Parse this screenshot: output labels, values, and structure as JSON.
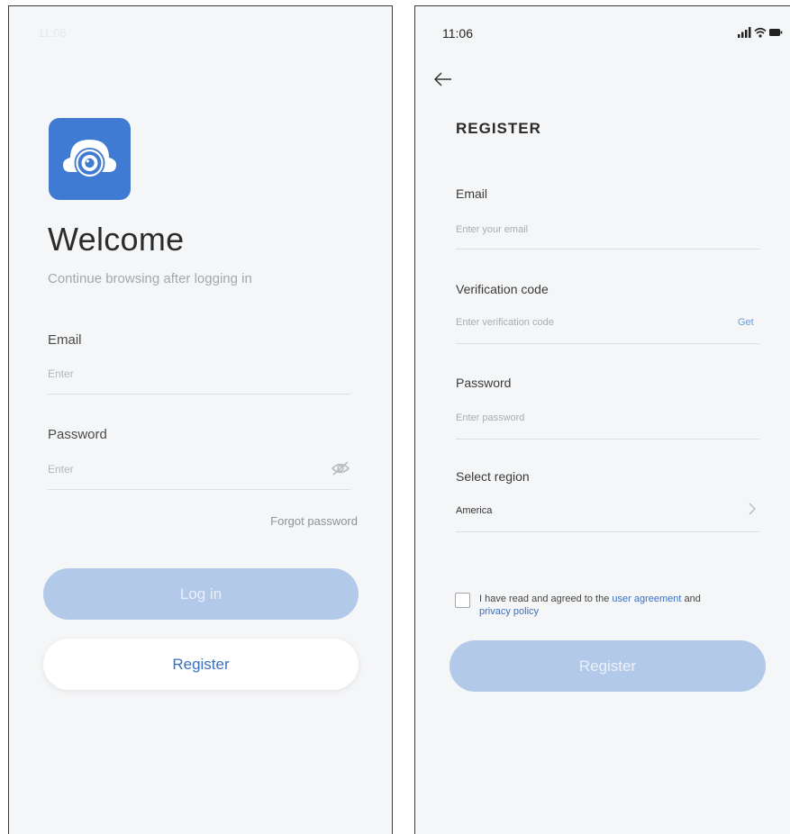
{
  "login_screen": {
    "ghost_status_time": "11:06",
    "welcome_title": "Welcome",
    "subtitle": "Continue browsing after logging in",
    "email": {
      "label": "Email",
      "placeholder": "Enter"
    },
    "password": {
      "label": "Password",
      "placeholder": "Enter"
    },
    "forgot_password": "Forgot password",
    "login_button": "Log in",
    "register_button": "Register",
    "logo_icon": "camera-app-logo-icon",
    "password_toggle_icon": "eye-off-icon",
    "colors": {
      "logo": "#3f7bd3",
      "primary_disabled": "#b2c9ea",
      "link": "#3a6fc0"
    }
  },
  "register_screen": {
    "status_bar": {
      "time": "11:06",
      "icons": [
        "signal-icon",
        "wifi-icon",
        "battery-icon"
      ]
    },
    "back_icon": "back-arrow-icon",
    "title": "REGISTER",
    "email": {
      "label": "Email",
      "placeholder": "Enter your email"
    },
    "verification": {
      "label": "Verification code",
      "placeholder": "Enter verification code",
      "action": "Get"
    },
    "password": {
      "label": "Password",
      "placeholder": "Enter password"
    },
    "region": {
      "label": "Select region",
      "value": "America",
      "chevron_icon": "chevron-right-icon"
    },
    "agreement": {
      "prefix": "I have read and agreed to the",
      "user_agreement": "user agreement",
      "and": "and",
      "privacy_policy": "privacy policy"
    },
    "register_button": "Register"
  }
}
